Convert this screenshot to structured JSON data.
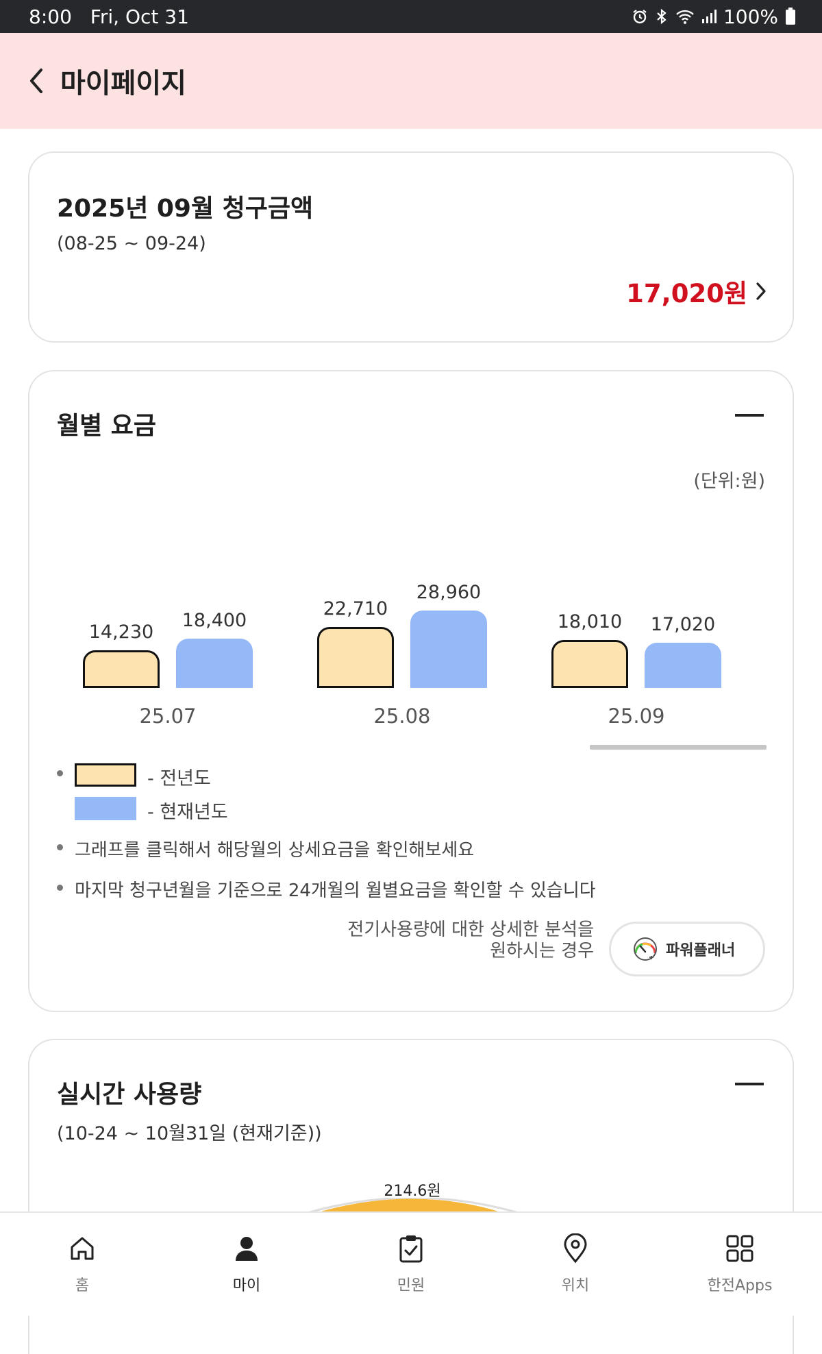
{
  "status_bar": {
    "time": "8:00",
    "date": "Fri, Oct 31",
    "battery": "100%"
  },
  "header": {
    "title": "마이페이지"
  },
  "bill_card": {
    "title": "2025년 09월 청구금액",
    "period": "(08-25 ~ 09-24)",
    "amount": "17,020원"
  },
  "monthly_card": {
    "title": "월별 요금",
    "unit": "(단위:원)",
    "legend_prev": "- 전년도",
    "legend_curr": "- 현재년도",
    "note_1": "그래프를 클릭해서 해당월의 상세요금을 확인해보세요",
    "note_2": "마지막 청구년월을 기준으로 24개월의 월별요금을 확인할 수 있습니다",
    "planner_desc_line1": "전기사용량에 대한 상세한 분석을",
    "planner_desc_line2": "원하시는 경우",
    "planner_button": "파워플래너",
    "colors": {
      "previous_year": "#fde3b0",
      "current_year": "#94b9f6"
    }
  },
  "chart_data": {
    "type": "bar",
    "categories": [
      "25.07",
      "25.08",
      "25.09"
    ],
    "series": [
      {
        "name": "전년도",
        "values": [
          14230,
          22710,
          18010
        ],
        "labels": [
          "14,230",
          "22,710",
          "18,010"
        ]
      },
      {
        "name": "현재년도",
        "values": [
          18400,
          28960,
          17020
        ],
        "labels": [
          "18,400",
          "28,960",
          "17,020"
        ]
      }
    ],
    "ylabel": "(단위:원)",
    "grid": false,
    "legend": "bottom-left"
  },
  "realtime_card": {
    "title": "실시간 사용량",
    "period": "(10-24 ~ 10월31일 (현재기준))",
    "gauge_value": "214.6원"
  },
  "bottom_nav": {
    "items": [
      {
        "label": "홈",
        "icon": "home-icon"
      },
      {
        "label": "마이",
        "icon": "person-icon"
      },
      {
        "label": "민원",
        "icon": "clipboard-check-icon"
      },
      {
        "label": "위치",
        "icon": "location-pin-icon"
      },
      {
        "label": "한전Apps",
        "icon": "apps-grid-icon"
      }
    ],
    "active_index": 1
  }
}
